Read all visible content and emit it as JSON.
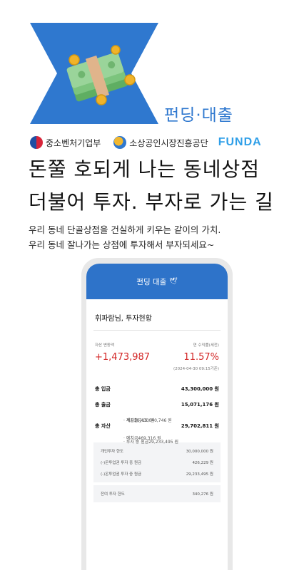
{
  "brand": {
    "title": "펀딩·대출"
  },
  "logos": {
    "ministry": "중소벤처기업부",
    "agency": "소상공인시장진흥공단",
    "funda": "FUNDA"
  },
  "headline": {
    "line1": "돈쭐 호되게 나는 동네상점",
    "line2": "더불어 투자. 부자로 가는 길"
  },
  "subtitle": {
    "line1": "우리 동네 단골상점을 건실하게 키우는 같이의 가치.",
    "line2": "우리 동네 잘나가는 상점에 투자해서 부자되세요~"
  },
  "app": {
    "header_title": "펀딩 대출",
    "greeting": "휘파람님, 투자현황",
    "asset_change_label": "자산 변동액",
    "asset_change_value": "+1,473,987",
    "yield_label": "연 수익률(세전)",
    "yield_value": "11.57%",
    "as_of": "(2024-04-30 09:15기준)",
    "total_deposit_label": "총 입금",
    "total_deposit_value": "43,300,000 원",
    "total_withdraw_label": "총 출금",
    "total_withdraw_value": "15,071,176 원",
    "account_withdraw_label": "· 계좌출금",
    "account_withdraw_value": "15,040,746 원",
    "tax_label": "· 세금",
    "tax_value": "30,430 원",
    "total_asset_label": "총 자산",
    "total_asset_value": "29,702,811 원",
    "deposit_label": "· 예치금",
    "deposit_value": "469,316 원",
    "invest_principal_label": "· 투자 중 원금",
    "invest_principal_value": "29,233,495 원",
    "limits": [
      {
        "label": "개인투자 한도",
        "value": "30,000,000 원"
      },
      {
        "label": "(-)온투업권 투자 중 원금",
        "value": "426,229 원"
      },
      {
        "label": "(-)온투업권 투자 중 원금",
        "value": "29,233,495 원"
      }
    ],
    "remaining_label": "잔여 투자 한도",
    "remaining_value": "340,276 원"
  },
  "colors": {
    "accent": "#2f78cf",
    "profit_red": "#d32626",
    "funda_blue": "#2f9fe8"
  }
}
